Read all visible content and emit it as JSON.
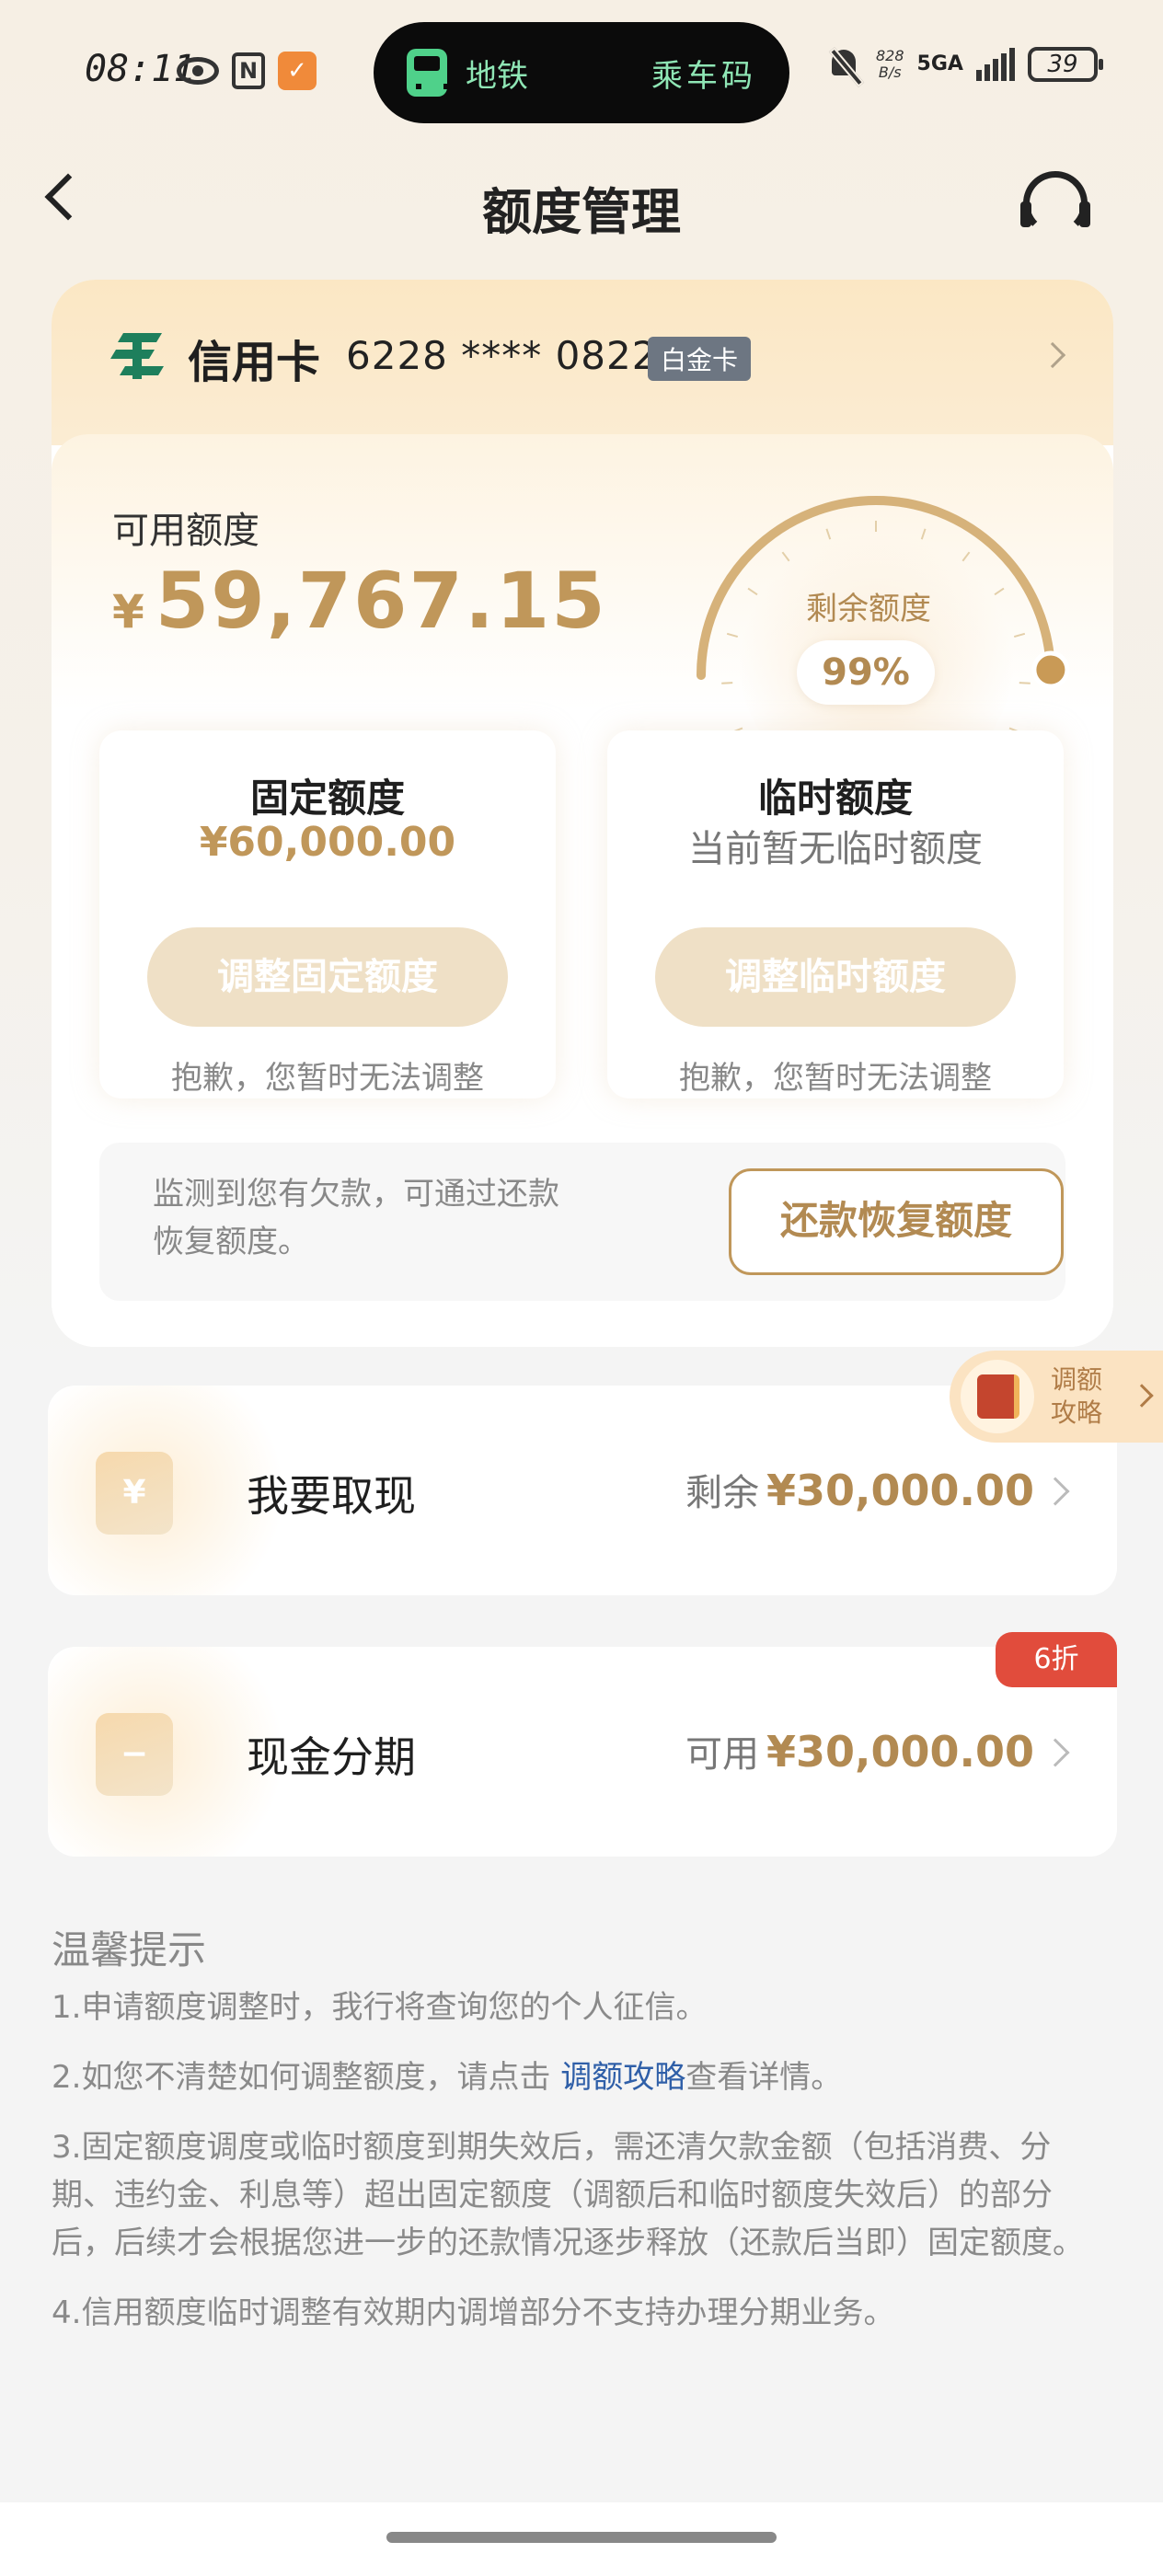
{
  "status_bar": {
    "time": "08:11",
    "shield_glyph": "✓",
    "island_left": "地铁",
    "island_right": "乘车码",
    "net_speed_value": "828",
    "net_speed_unit": "B/s",
    "network": "5GA",
    "battery": "39"
  },
  "header": {
    "title": "额度管理",
    "icons": [
      "back-icon",
      "headset-icon"
    ]
  },
  "card": {
    "type": "信用卡",
    "number": "6228 **** 0822",
    "badge": "白金卡"
  },
  "credit": {
    "available_label": "可用额度",
    "currency": "¥",
    "available_value": "59,767.15",
    "gauge_label": "剩余额度",
    "gauge_percent_text": "99%",
    "gauge_level": 0.99
  },
  "fixed": {
    "title": "固定额度",
    "value": "¥60,000.00",
    "button": "调整固定额度",
    "note": "抱歉，您暂时无法调整"
  },
  "temporary": {
    "title": "临时额度",
    "value": "当前暂无临时额度",
    "button": "调整临时额度",
    "note": "抱歉，您暂时无法调整"
  },
  "debt": {
    "message": "监测到您有欠款，可通过还款恢复额度。",
    "button": "还款恢复额度"
  },
  "strategy": {
    "line1": "调额",
    "line2": "攻略"
  },
  "withdraw": {
    "label": "我要取现",
    "icon_glyph": "¥",
    "prefix": "剩余",
    "amount": "¥30,000.00"
  },
  "installment": {
    "label": "现金分期",
    "icon_glyph": "−",
    "prefix": "可用",
    "amount": "¥30,000.00",
    "badge": "6折"
  },
  "tips": {
    "title": "温馨提示",
    "item1": "1.申请额度调整时，我行将查询您的个人征信。",
    "item2_before": "2.如您不清楚如何调整额度，请点击 ",
    "item2_link": "调额攻略",
    "item2_after": "查看详情。",
    "item3": "3.固定额度调度或临时额度到期失效后，需还清欠款金额（包括消费、分期、违约金、利息等）超出固定额度（调额后和临时额度失效后）的部分后，后续才会根据您进一步的还款情况逐步释放（还款后当即）固定额度。",
    "item4": "4.信用额度临时调整有效期内调增部分不支持办理分期业务。"
  },
  "colors": {
    "accent_gold": "#c0975a",
    "link_blue": "#2f5fa8",
    "badge_red": "#e14c3c",
    "island_green": "#4fd18a"
  }
}
